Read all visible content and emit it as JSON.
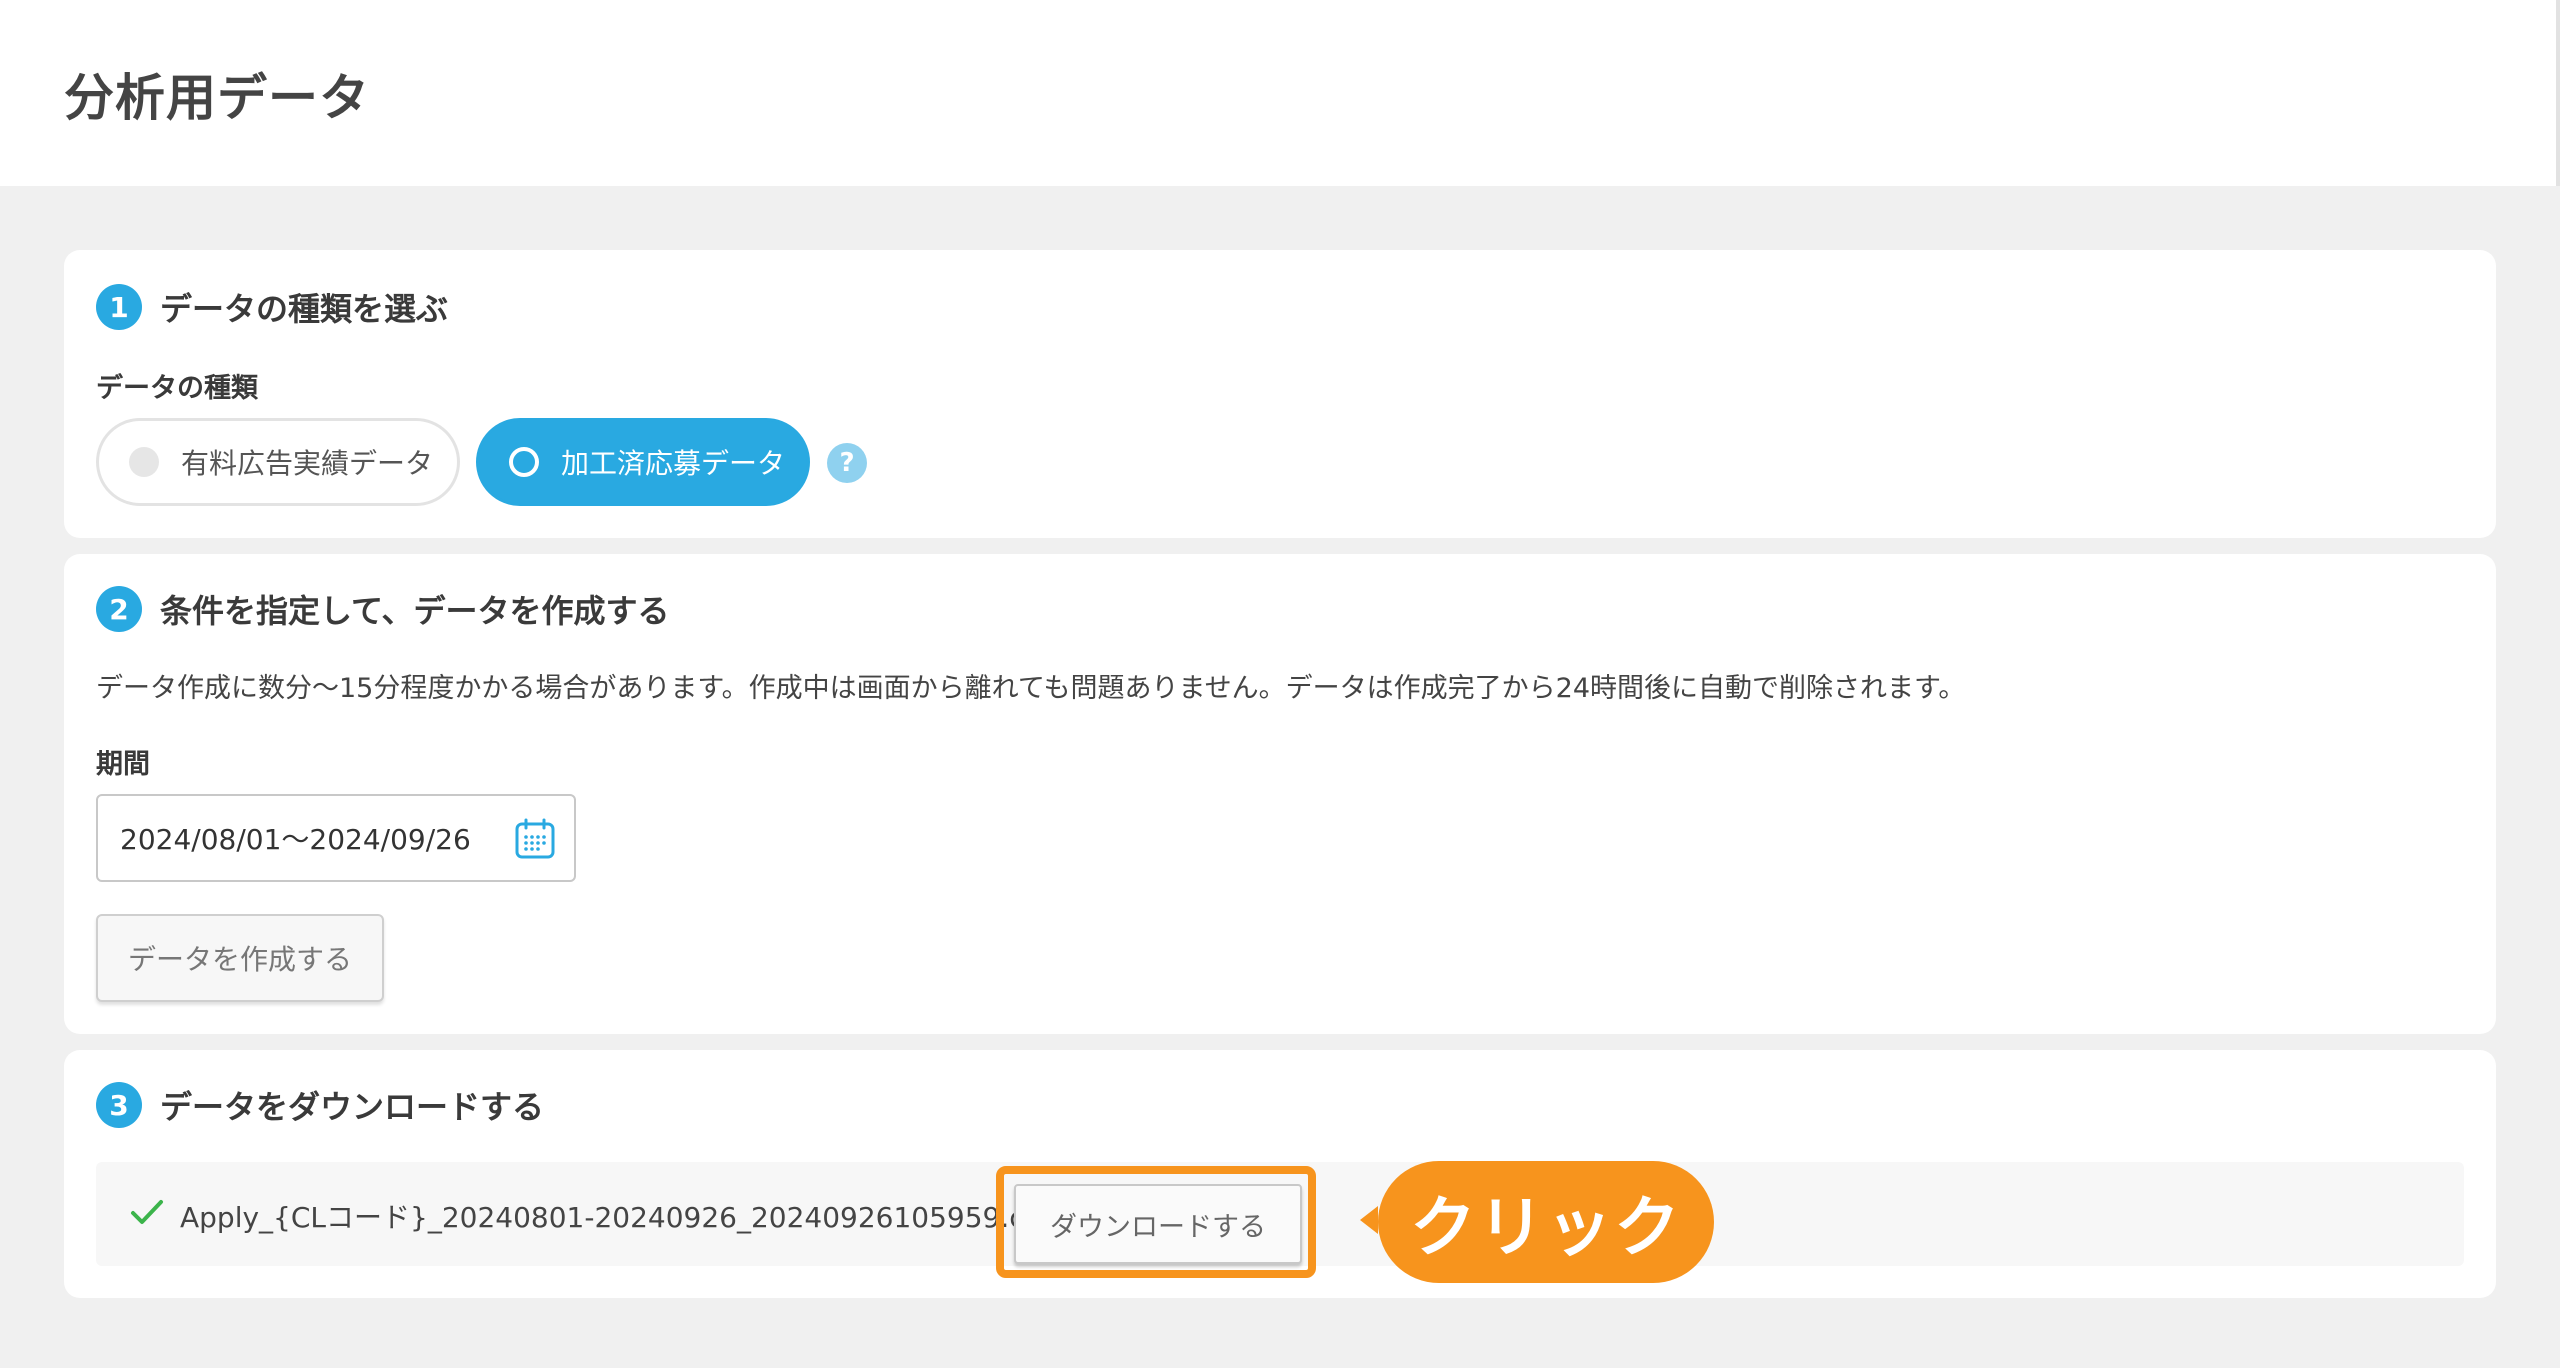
{
  "header": {
    "title": "分析用データ"
  },
  "step1": {
    "number": "1",
    "title": "データの種類を選ぶ",
    "field_label": "データの種類",
    "options": [
      {
        "label": "有料広告実績データ",
        "selected": false
      },
      {
        "label": "加工済応募データ",
        "selected": true
      }
    ],
    "help_icon": "?"
  },
  "step2": {
    "number": "2",
    "title": "条件を指定して、データを作成する",
    "description": "データ作成に数分〜15分程度かかる場合があります。作成中は画面から離れても問題ありません。データは作成完了から24時間後に自動で削除されます。",
    "period_label": "期間",
    "period_value": "2024/08/01〜2024/09/26",
    "calendar_icon": "calendar-icon",
    "create_button": "データを作成する"
  },
  "step3": {
    "number": "3",
    "title": "データをダウンロードする",
    "file_name": "Apply_{CLコード}_20240801-20240926_20240926105959.csv",
    "download_button": "ダウンロードする",
    "callout": "クリック"
  },
  "colors": {
    "accent": "#29a9e1",
    "callout": "#f7941d",
    "success": "#3cb44b",
    "background": "#f0f0f0"
  }
}
